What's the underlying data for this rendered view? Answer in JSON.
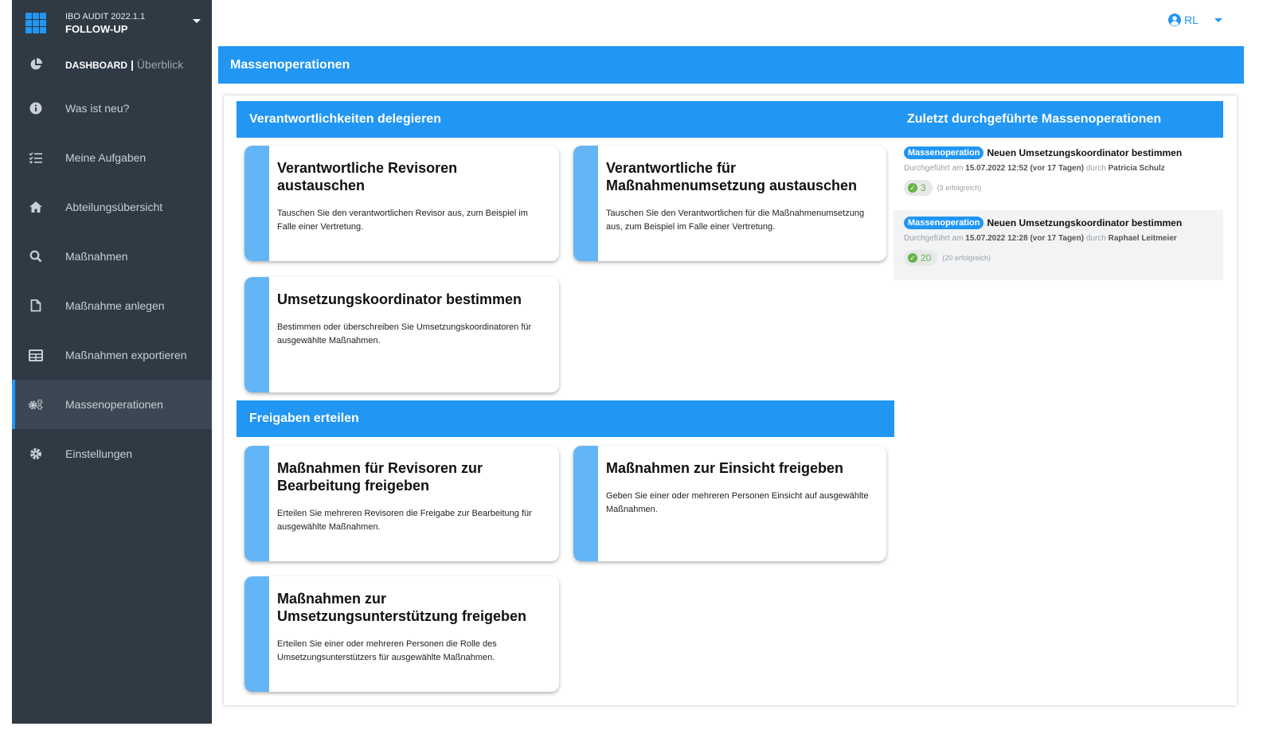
{
  "app": {
    "version": "IBO AUDIT 2022.1.1",
    "module": "FOLLOW-UP"
  },
  "sidebar": {
    "dashboard": {
      "strong": "DASHBOARD",
      "sep": "|",
      "light": "Überblick"
    },
    "items": [
      {
        "label": "Was ist neu?",
        "icon": "info-icon"
      },
      {
        "label": "Meine Aufgaben",
        "icon": "task-list-icon"
      },
      {
        "label": "Abteilungsübersicht",
        "icon": "home-icon"
      },
      {
        "label": "Maßnahmen",
        "icon": "search-icon"
      },
      {
        "label": "Maßnahme anlegen",
        "icon": "file-icon"
      },
      {
        "label": "Maßnahmen exportieren",
        "icon": "table-icon"
      },
      {
        "label": "Massenoperationen",
        "icon": "gears-icon",
        "active": true
      },
      {
        "label": "Einstellungen",
        "icon": "gear-icon"
      }
    ]
  },
  "user": {
    "initials": "RL"
  },
  "page": {
    "title": "Massenoperationen"
  },
  "sections": {
    "delegate": {
      "title": "Verantwortlichkeiten delegieren",
      "cards": [
        {
          "title": "Verantwortliche Revisoren austauschen",
          "desc": "Tauschen Sie den verantwortlichen Revisor aus, zum Beispiel im Falle einer Vertretung."
        },
        {
          "title": "Verantwortliche für Maßnahmenumsetzung austauschen",
          "desc": "Tauschen Sie den Verantwortlichen für die Maßnahmenumsetzung aus, zum Beispiel im Falle einer Vertretung."
        },
        {
          "title": "Umsetzungskoordinator bestimmen",
          "desc": "Bestimmen oder überschreiben Sie Umsetzungskoordinatoren für ausgewählte Maßnahmen."
        }
      ]
    },
    "release": {
      "title": "Freigaben erteilen",
      "cards": [
        {
          "title": "Maßnahmen für Revisoren zur Bearbeitung freigeben",
          "desc": "Erteilen Sie mehreren Revisoren die Freigabe zur Bearbeitung für ausgewählte Maßnahmen."
        },
        {
          "title": "Maßnahmen zur Einsicht freigeben",
          "desc": "Geben Sie einer oder mehreren Personen Einsicht auf ausgewählte Maßnahmen."
        },
        {
          "title": "Maßnahmen zur Umsetzungsunterstützung freigeben",
          "desc": "Erteilen Sie einer oder mehreren Personen die Rolle des Umsetzungsunterstützers für ausgewählte Maßnahmen."
        }
      ]
    },
    "recent": {
      "title": "Zuletzt durchgeführte Massenoperationen",
      "items": [
        {
          "badge": "Massenoperation",
          "title": "Neuen Umsetzungskoordinator bestimmen",
          "prefix": "Durchgeführt am",
          "when": "15.07.2022 12:52 (vor 17 Tagen)",
          "by_word": "durch",
          "by": "Patricia Schulz",
          "count": "3",
          "ok": "(3 erfolgreich)"
        },
        {
          "badge": "Massenoperation",
          "title": "Neuen Umsetzungskoordinator bestimmen",
          "prefix": "Durchgeführt am",
          "when": "15.07.2022 12:28 (vor 17 Tagen)",
          "by_word": "durch",
          "by": "Raphael Leitmeier",
          "count": "20",
          "ok": "(20 erfolgreich)"
        }
      ]
    }
  },
  "colors": {
    "accent": "#2196f3",
    "sidebar": "#2f3a45",
    "stripe": "#64b5f6",
    "success": "#67b346"
  }
}
